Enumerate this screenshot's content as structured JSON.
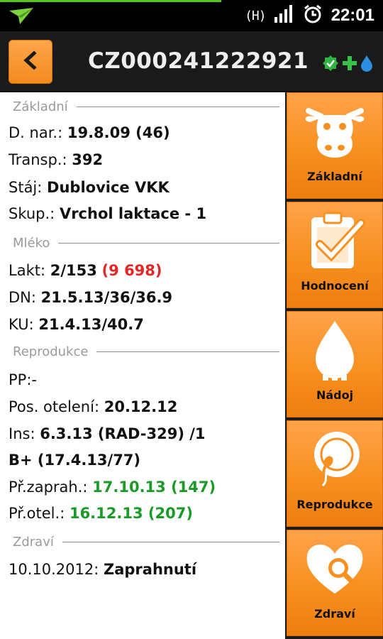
{
  "status_bar": {
    "network": "(H)",
    "time": "22:01",
    "icons": [
      "paper-plane-icon",
      "network-type-icon",
      "signal-icon",
      "alarm-clock-icon"
    ]
  },
  "header": {
    "title": "CZ000241222921",
    "back_icon": "chevron-left-icon",
    "status_icons": [
      "check-badge-icon",
      "plus-icon",
      "drop-icon"
    ]
  },
  "sections": {
    "basic": {
      "title": "Základní",
      "birth_label": "D. nar.:",
      "birth_value": "19.8.09 (46)",
      "transp_label": "Transp.:",
      "transp_value": "392",
      "stable_label": "Stáj:",
      "stable_value": "Dublovice VKK",
      "group_label": "Skup.:",
      "group_value": "Vrchol laktace - 1"
    },
    "milk": {
      "title": "Mléko",
      "lakt_label": "Lakt:",
      "lakt_value": "2/153",
      "lakt_extra": "(9 698)",
      "dn_label": "DN:",
      "dn_value": "21.5.13/36/36.9",
      "ku_label": "KU:",
      "ku_value": "21.4.13/40.7"
    },
    "reproduction": {
      "title": "Reprodukce",
      "pp_label": "PP:",
      "pp_value": "-",
      "calving_label": "Pos. otelení:",
      "calving_value": "20.12.12",
      "ins_label": "Ins:",
      "ins_value": "6.3.13 (RAD-329) /1",
      "ins_line2": "B+ (17.4.13/77)",
      "preg_label": "Př.zaprah.:",
      "preg_value": "17.10.13 (147)",
      "next_calving_label": "Př.otel.:",
      "next_calving_value": "16.12.13 (207)"
    },
    "health": {
      "title": "Zdraví",
      "entry_date": "10.10.2012:",
      "entry_value": "Zaprahnutí"
    }
  },
  "sidebar": {
    "items": [
      {
        "label": "Základní",
        "icon": "cow-head-icon"
      },
      {
        "label": "Hodnocení",
        "icon": "clipboard-check-icon"
      },
      {
        "label": "Nádoj",
        "icon": "milk-drop-icon"
      },
      {
        "label": "Reprodukce",
        "icon": "sperm-egg-icon"
      },
      {
        "label": "Zdraví",
        "icon": "heart-search-icon"
      }
    ]
  },
  "colors": {
    "accent": "#f7901f",
    "header_bg": "#1a1a1a",
    "green": "#1a9a26",
    "red": "#e32626"
  }
}
